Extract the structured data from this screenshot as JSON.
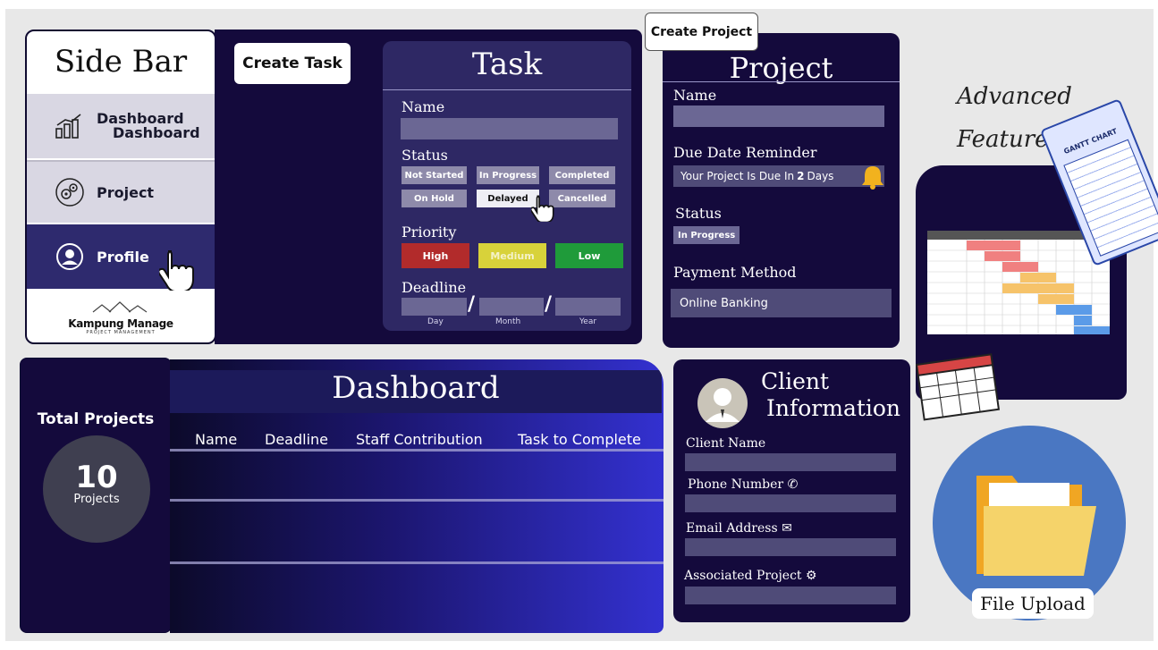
{
  "sidebar": {
    "title": "Side Bar",
    "items": [
      {
        "label": "Dashboard",
        "label2": "Dashboard",
        "icon": "chart-icon"
      },
      {
        "label": "Project",
        "icon": "gears-icon"
      },
      {
        "label": "Profile",
        "icon": "user-icon"
      }
    ],
    "logo": {
      "name": "Kampung Manage",
      "sub": "PROJECT MANAGEMENT"
    }
  },
  "task_form": {
    "create_button": "Create Task",
    "title": "Task",
    "name_label": "Name",
    "status_label": "Status",
    "statuses": [
      "Not Started",
      "In Progress",
      "Completed",
      "On Hold",
      "Delayed",
      "Cancelled"
    ],
    "selected_status": "Delayed",
    "priority_label": "Priority",
    "priorities": [
      "High",
      "Medium",
      "Low"
    ],
    "priority_colors": [
      "#b22b2b",
      "#d8d23a",
      "#1f9b3a"
    ],
    "deadline_label": "Deadline",
    "deadline_parts": [
      "Day",
      "Month",
      "Year"
    ]
  },
  "project_form": {
    "create_button": "Create Project",
    "title": "Project",
    "name_label": "Name",
    "due_label": "Due Date Reminder",
    "due_text_prefix": "Your Project Is Due In ",
    "due_days": "2",
    "due_text_suffix": " Days",
    "status_label": "Status",
    "status_value": "In Progress",
    "payment_label": "Payment Method",
    "payment_value": "Online Banking"
  },
  "advanced": {
    "title_line1": "Advanced",
    "title_line2": "Features",
    "gantt_label": "GANTT CHART"
  },
  "stats": {
    "title": "Total Projects",
    "count": "10",
    "unit": "Projects"
  },
  "dashboard": {
    "title": "Dashboard",
    "columns": [
      "Name",
      "Deadline",
      "Staff Contribution",
      "Task to Complete"
    ]
  },
  "client": {
    "title_line1": "Client",
    "title_line2": "Information",
    "fields": [
      "Client Name",
      "Phone Number",
      "Email Address",
      "Associated Project"
    ]
  },
  "file_upload": {
    "label": "File Upload"
  },
  "colors": {
    "navy": "#140a3c",
    "card": "#2e2864",
    "accent_blue": "#3331d0",
    "bell": "#f2b21e"
  }
}
